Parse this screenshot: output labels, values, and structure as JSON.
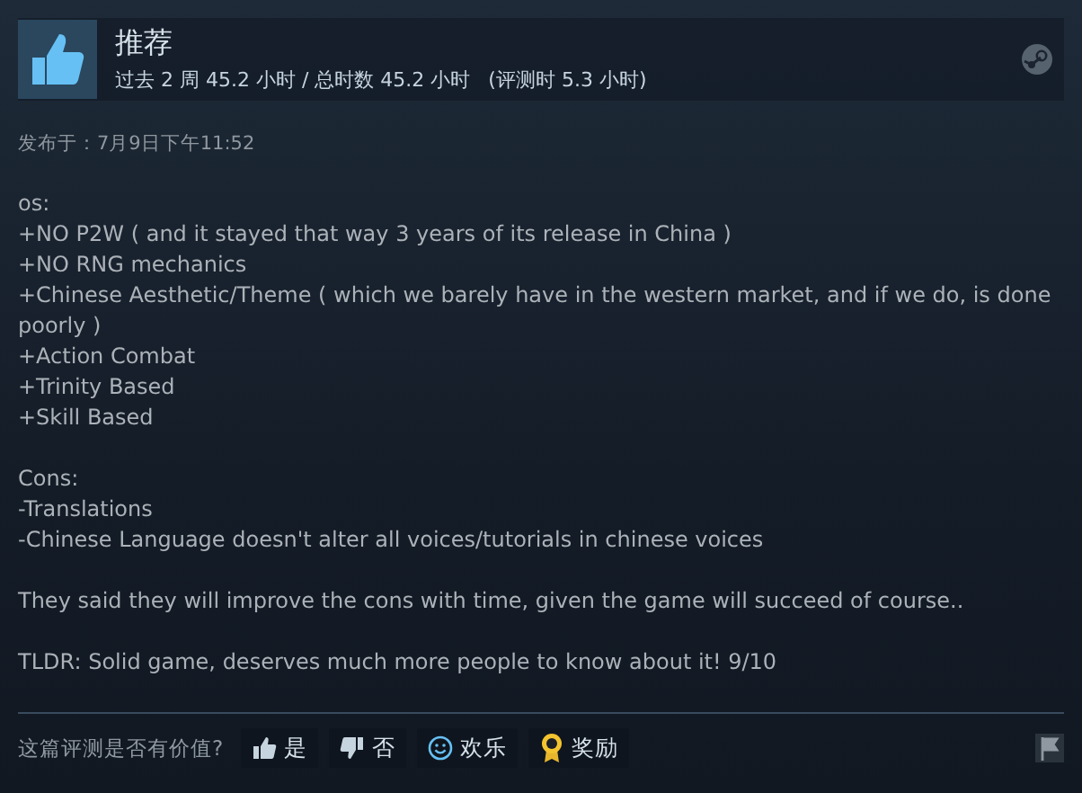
{
  "review": {
    "verdict": "推荐",
    "hours": "过去 2 周 45.2 小时 / 总时数 45.2 小时",
    "review_hours": "(评测时 5.3 小时)",
    "posted": "发布于：7月9日下午11:52",
    "paragraphs": [
      [
        "os:",
        "+NO P2W ( and it stayed that way 3 years of its release in China )",
        "+NO RNG mechanics",
        "+Chinese Aesthetic/Theme ( which we barely have in the western market, and if we do, is done poorly )",
        "+Action Combat",
        "+Trinity Based",
        "+Skill Based"
      ],
      [
        "Cons:",
        "-Translations",
        "-Chinese Language doesn't alter all voices/tutorials in chinese voices"
      ],
      [
        "They said they will improve the cons with time, given the game will succeed of course.."
      ],
      [
        "TLDR: Solid game, deserves much more people to know about it! 9/10"
      ]
    ]
  },
  "footer": {
    "question": "这篇评测是否有价值?",
    "buttons": [
      {
        "kind": "yes",
        "label": "是"
      },
      {
        "kind": "no",
        "label": "否"
      },
      {
        "kind": "funny",
        "label": "欢乐"
      },
      {
        "kind": "award",
        "label": "奖励"
      }
    ]
  }
}
